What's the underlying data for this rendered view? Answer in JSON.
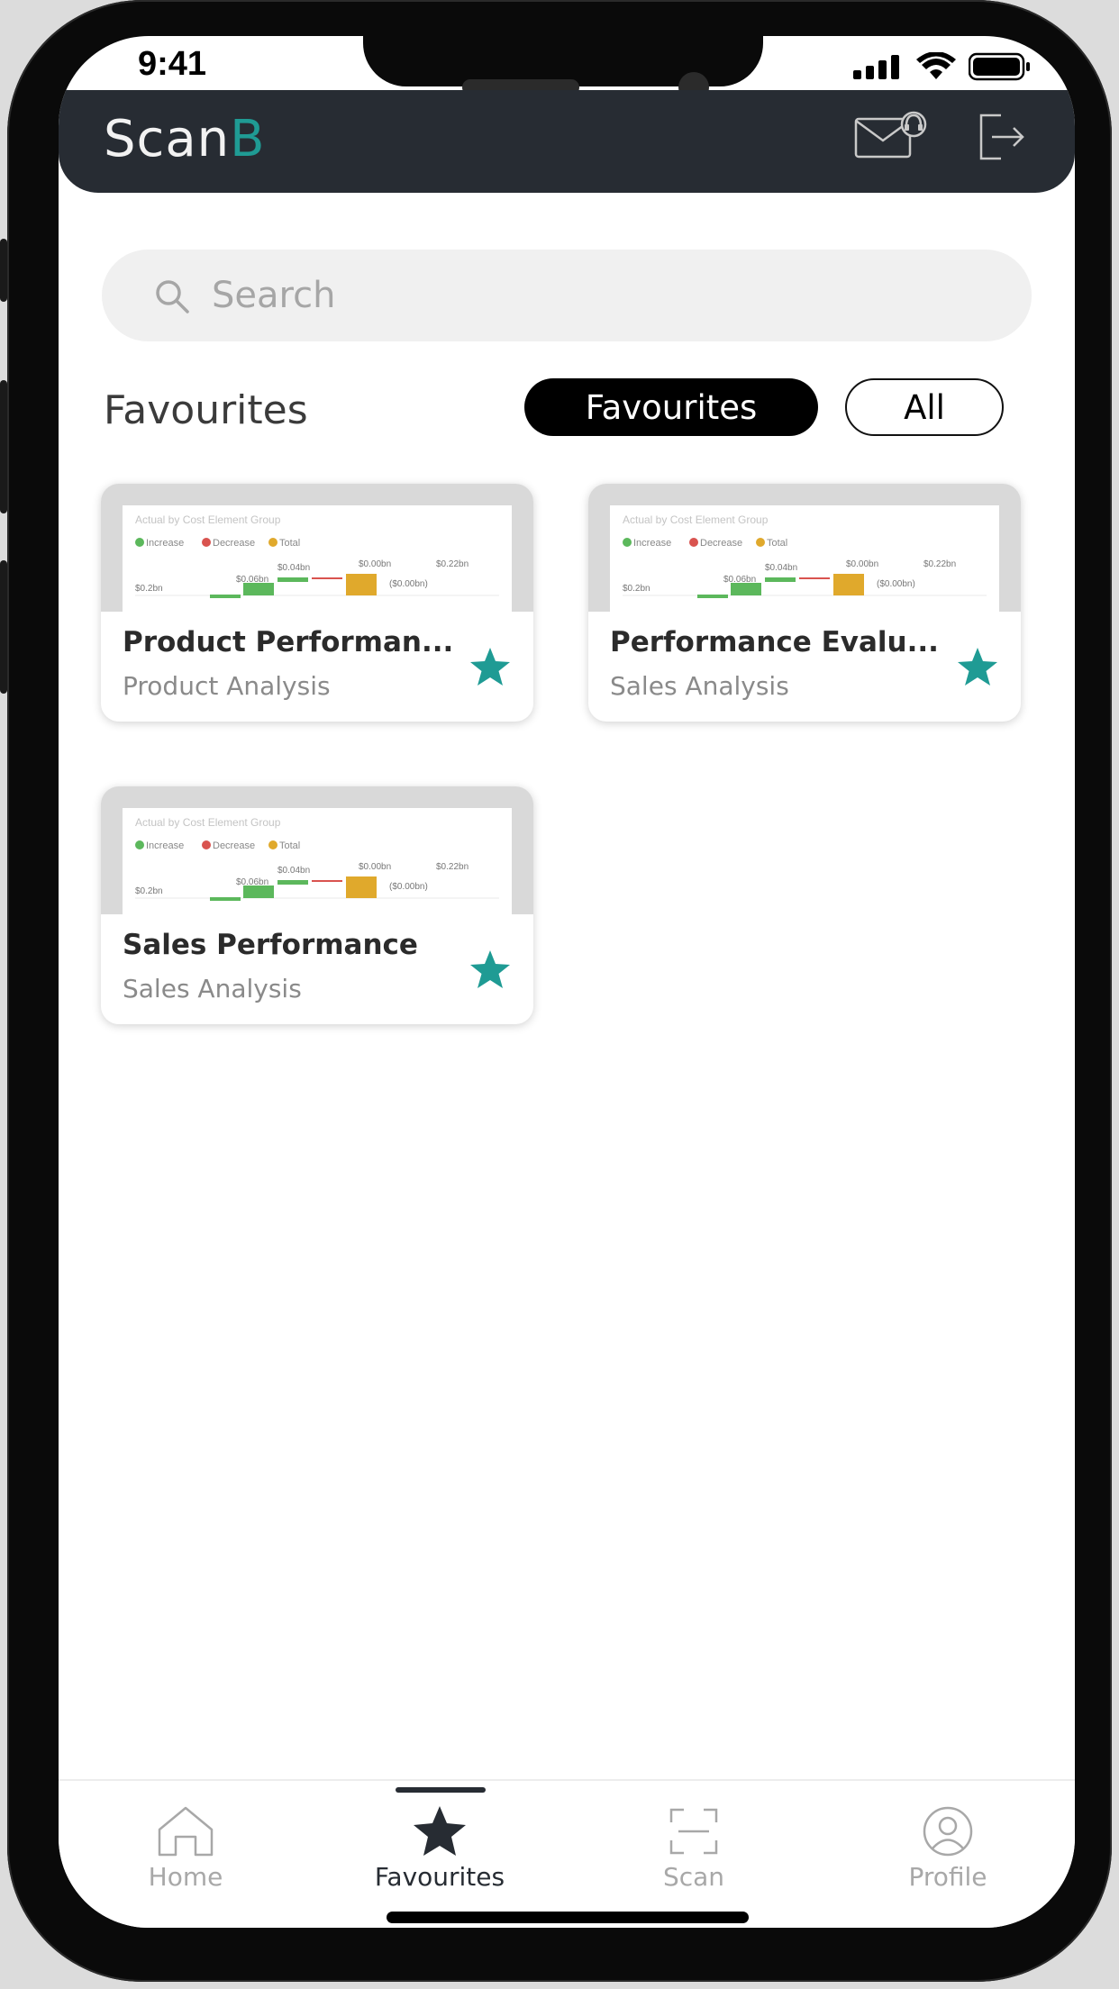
{
  "status_bar": {
    "time": "9:41"
  },
  "app": {
    "logo_main": "Scan",
    "logo_accent": "B",
    "accent_color": "#1f9b94",
    "header_color": "#272c33"
  },
  "header_icons": {
    "mail": "mail-support-icon",
    "logout": "logout-icon"
  },
  "search": {
    "placeholder": "Search"
  },
  "section": {
    "title": "Favourites"
  },
  "filters": {
    "favourites_label": "Favourites",
    "all_label": "All",
    "selected": "Favourites"
  },
  "cards": [
    {
      "title": "Product Performan...",
      "subtitle": "Product Analysis"
    },
    {
      "title": "Performance Evalu...",
      "subtitle": "Sales Analysis"
    },
    {
      "title": "Sales Performance",
      "subtitle": "Sales Analysis"
    }
  ],
  "thumbnail": {
    "title": "Actual by Cost Element Group",
    "legend": [
      "Increase",
      "Decrease",
      "Total"
    ],
    "legend_colors": [
      "#5cb85c",
      "#d9534f",
      "#e0a92c"
    ],
    "labels": [
      "$0.2bn",
      "$0.06bn",
      "$0.04bn",
      "$0.00bn",
      "($0.00bn)",
      "$0.22bn"
    ]
  },
  "tabs": [
    {
      "label": "Home",
      "icon": "home-icon"
    },
    {
      "label": "Favourites",
      "icon": "star-icon",
      "active": true
    },
    {
      "label": "Scan",
      "icon": "scan-icon"
    },
    {
      "label": "Profile",
      "icon": "profile-icon"
    }
  ]
}
